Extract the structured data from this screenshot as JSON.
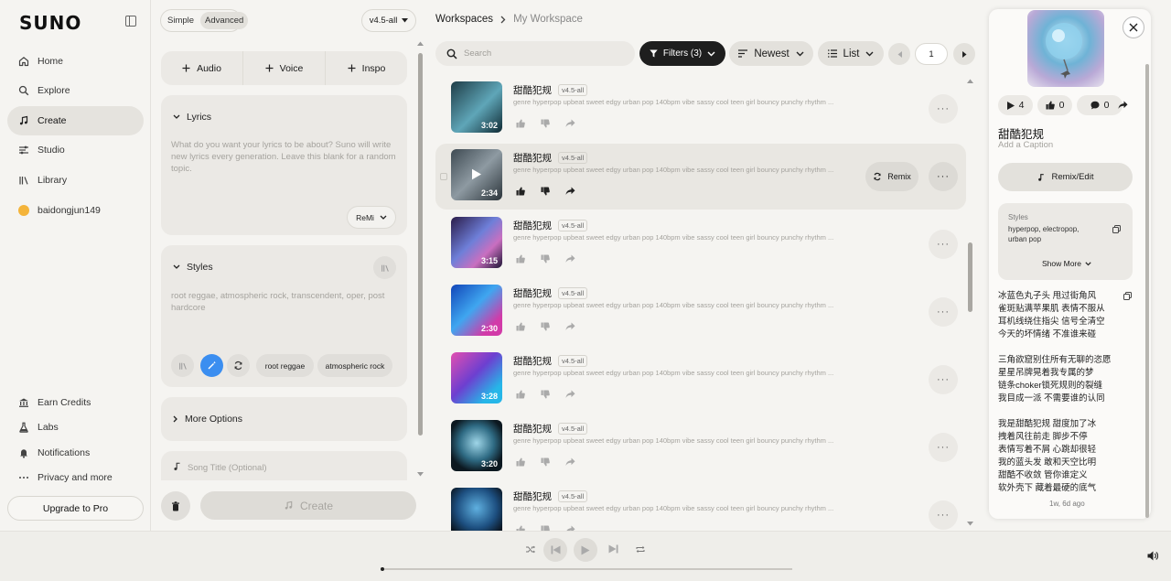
{
  "sidebar": {
    "logo": "SUNO",
    "nav": [
      {
        "label": "Home",
        "icon": "home-icon"
      },
      {
        "label": "Explore",
        "icon": "search-icon"
      },
      {
        "label": "Create",
        "icon": "music-note-icon",
        "active": true
      },
      {
        "label": "Studio",
        "icon": "studio-icon"
      },
      {
        "label": "Library",
        "icon": "library-icon"
      },
      {
        "label": "baidongjun149",
        "icon": "avatar"
      }
    ],
    "bottom_nav": [
      {
        "label": "Earn Credits",
        "icon": "bank-icon"
      },
      {
        "label": "Labs",
        "icon": "flask-icon"
      },
      {
        "label": "Notifications",
        "icon": "bell-icon"
      },
      {
        "label": "Privacy and more",
        "icon": "more-icon"
      }
    ],
    "upgrade_label": "Upgrade to Pro"
  },
  "create": {
    "mode_simple": "Simple",
    "mode_advanced": "Advanced",
    "model": "v4.5-all",
    "add_audio": "Audio",
    "add_voice": "Voice",
    "add_inspo": "Inspo",
    "lyrics_title": "Lyrics",
    "lyrics_placeholder": "What do you want your lyrics to be about? Suno will write new lyrics every generation. Leave this blank for a random topic.",
    "remi_label": "ReMi",
    "styles_title": "Styles",
    "styles_value": "root reggae, atmospheric rock, transcendent, oper, post hardcore",
    "style_chip_1": "root reggae",
    "style_chip_2": "atmospheric rock",
    "more_options": "More Options",
    "song_title_placeholder": "Song Title (Optional)",
    "create_label": "Create"
  },
  "main": {
    "breadcrumb_root": "Workspaces",
    "breadcrumb_current": "My Workspace",
    "search_placeholder": "Search",
    "filters_label": "Filters (3)",
    "sort_label": "Newest",
    "view_label": "List",
    "page": "1",
    "remix_label": "Remix",
    "songs": [
      {
        "title": "甜酷犯规",
        "version": "v4.5-all",
        "tags": "genre hyperpop upbeat sweet edgy urban pop 140bpm vibe sassy cool teen girl bouncy punchy rhythm ...",
        "duration": "3:02",
        "bg": "linear-gradient(135deg,#1e3c46,#5fa6b8 55%,#0f2a33)"
      },
      {
        "title": "甜酷犯规",
        "version": "v4.5-all",
        "tags": "genre hyperpop upbeat sweet edgy urban pop 140bpm vibe sassy cool teen girl bouncy punchy rhythm ...",
        "duration": "2:34",
        "bg": "linear-gradient(135deg,#3e4a52,#8e9aa2 50%,#2b343a)"
      },
      {
        "title": "甜酷犯规",
        "version": "v4.5-all",
        "tags": "genre hyperpop upbeat sweet edgy urban pop 140bpm vibe sassy cool teen girl bouncy punchy rhythm ...",
        "duration": "3:15",
        "bg": "linear-gradient(135deg,#2a1b48,#6e7fd8 45%,#c96fc0 70%,#1d1535)"
      },
      {
        "title": "甜酷犯规",
        "version": "v4.5-all",
        "tags": "genre hyperpop upbeat sweet edgy urban pop 140bpm vibe sassy cool teen girl bouncy punchy rhythm ...",
        "duration": "2:30",
        "bg": "linear-gradient(135deg,#1245b8,#3fa6f0 45%,#d23aa8 80%)"
      },
      {
        "title": "甜酷犯规",
        "version": "v4.5-all",
        "tags": "genre hyperpop upbeat sweet edgy urban pop 140bpm vibe sassy cool teen girl bouncy punchy rhythm ...",
        "duration": "3:28",
        "bg": "linear-gradient(135deg,#e34fb0,#6d3fd0 45%,#26b6e8 80%)"
      },
      {
        "title": "甜酷犯规",
        "version": "v4.5-all",
        "tags": "genre hyperpop upbeat sweet edgy urban pop 140bpm vibe sassy cool teen girl bouncy punchy rhythm ...",
        "duration": "3:20",
        "bg": "radial-gradient(circle at 50% 45%,#9fd6e8,#2f6b84 45%,#0c1820 75%)"
      },
      {
        "title": "甜酷犯规",
        "version": "v4.5-all",
        "tags": "genre hyperpop upbeat sweet edgy urban pop 140bpm vibe sassy cool teen girl bouncy punchy rhythm ...",
        "duration": "",
        "bg": "radial-gradient(circle at 50% 40%,#5fb0e0,#1d4f80 50%,#0b1622 80%)"
      }
    ]
  },
  "detail": {
    "plays": "4",
    "likes": "0",
    "comments": "0",
    "title": "甜酷犯规",
    "caption_placeholder": "Add a Caption",
    "remix_edit": "Remix/Edit",
    "styles_label": "Styles",
    "styles_value": "hyperpop, electropop, urban pop",
    "show_more": "Show More",
    "lyrics": "冰蓝色丸子头 甩过街角风\n雀斑贴满苹果肌 表情不服从\n耳机线绕住指尖 信号全清空\n今天的坏情绪 不准谁来碰\n\n三角欲窟别住所有无聊的恣愿\n星星吊牌晃着我专属的梦\n链条choker锁死规则的裂缝\n我目成一派 不需要谁的认同\n\n我是甜酷犯规 甜度加了冰\n拽着风往前走 脚步不停\n表情写着不屑 心跳却很轻\n我的蓝头发 敢和天空比明\n甜酷不收敛 管你谁定义\n软外壳下 藏着最硬的底气",
    "timestamp": "1w, 6d ago"
  },
  "colors": {
    "accent_blue": "#3b8ef0",
    "filter_bg": "#1e1e1e",
    "avatar": "#f4b43a"
  }
}
